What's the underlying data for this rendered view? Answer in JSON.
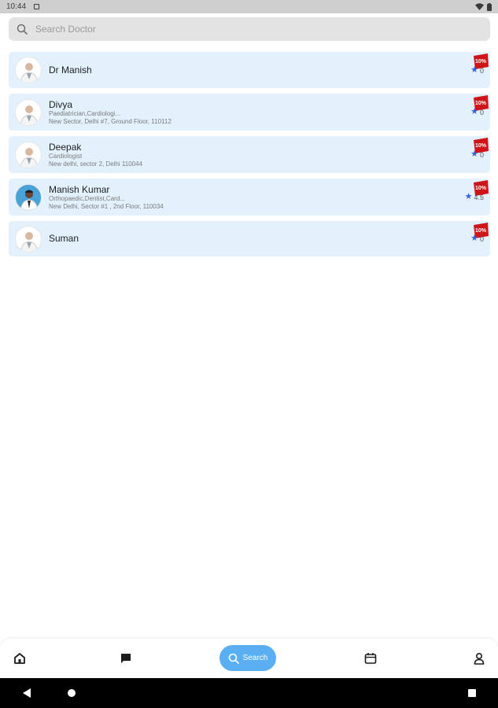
{
  "status_bar": {
    "time": "10:44"
  },
  "search": {
    "placeholder": "Search Doctor",
    "value": ""
  },
  "doctors": [
    {
      "name": "Dr Manish",
      "specialty": "",
      "address": "",
      "rating": "0",
      "discount": "10% OFF",
      "avatar": "doctor-avatar"
    },
    {
      "name": "Divya",
      "specialty": "Paediatrician,Cardiologi...",
      "address": "New Sector, Delhi #7, Ground Floor, 110112",
      "rating": "0",
      "discount": "10% OFF",
      "avatar": "doctor-avatar"
    },
    {
      "name": "Deepak",
      "specialty": "Cardiologist",
      "address": "New delhi, sector 2, Delhi 110044",
      "rating": "0",
      "discount": "10% OFF",
      "avatar": "doctor-avatar"
    },
    {
      "name": "Manish Kumar",
      "specialty": "Orthopaedic,Dentist,Card...",
      "address": "New Delhi, Sector #1 , 2nd Floor, 110034",
      "rating": "4.5",
      "discount": "10% OFF",
      "avatar": "doctor-photo"
    },
    {
      "name": "Suman",
      "specialty": "",
      "address": "",
      "rating": "0",
      "discount": "10% OFF",
      "avatar": "doctor-avatar"
    }
  ],
  "bottom_nav": {
    "items": [
      "home-icon",
      "chat-icon",
      "search-icon",
      "calendar-icon",
      "profile-icon"
    ],
    "search_label": "Search",
    "active_color": "#5aaef2"
  },
  "colors": {
    "card_bg": "#e3f1fd",
    "star": "#3c5fd6",
    "badge": "#d0151a"
  }
}
